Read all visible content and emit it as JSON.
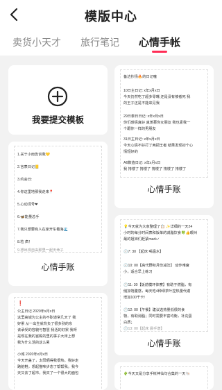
{
  "header": {
    "title": "模版中心"
  },
  "tabs": [
    {
      "label": "卖货小天才"
    },
    {
      "label": "旅行笔记"
    },
    {
      "label": "心情手帐"
    }
  ],
  "submit": {
    "label": "我要提交模板"
  },
  "templates": [
    {
      "title": "心情手账",
      "lines": [
        "备达抄扬🔥的日记噻",
        "10日主日记: x年x月x日",
        "今天仍然吃了超多零嘴 还是没有被者死 我",
        "的王子还是不能来见我",
        "29日泰日日记: x年x月x日",
        "你们感情真好 真羡慕你女朋友 我也素我一",
        "个跟你一样的男朋友",
        "31日主日记: x年x月x日",
        "今天心情不好打了两把王者 结果发现初个心",
        "情短好的",
        "A6数值日记: x年x月x日",
        "我 挎楼了 挎楼了 挎楼了 挎楼了 挎楼了",
        "挎楼了 挎楼了 挎楼了 挎楼了 挎楼了",
        "挎楼了 挎楼了 挎楼了"
      ]
    },
    {
      "title": "心情手账",
      "lines": [
        "1.关于小雨告诉我💛",
        "2.言表日记📒",
        "3.约会日:",
        "4.你这里地那我走来📍",
        "5.心动词号❤",
        "6.🦋能量总手",
        "7.我只想要有人在家开车看海🌊",
        "8.粒 疯！",
        "9.想出现自由那里一起天命子"
      ]
    },
    {
      "title": "心情手账",
      "lines": [
        "💡今天就为大家整理了📋 ✨详细的一天24",
        "小时的每分时间表和饭单的减脂饮食🍀👍眼州",
        "最的姐妹们赶紧mark✓",
        "🕖7: 30 【起床 喝温水】",
        "🕘10: 00【高代野积月份减法】 动作难度",
        "小，适合早上练习",
        "🕚11: 30【饭前模环体察】有助于燃脂，有",
        "储加饱腹感，每天吃4种绿茶叶控热量代谢",
        "增加100千卡!",
        "🕛12: 00【午餐】建议选热量低很的食",
        "物，有助消脂；同时需要丰富均衡，补充蛋",
        "白质；",
        "🕐13: 00【起床 晨手谱】"
      ]
    },
    {
      "title": "",
      "lines": [
        "❗",
        "公主日记 2020年x月x日",
        "这里高城为公主的不职道常几天了 我",
        "好累 从一出生就背负了很多别的东",
        "该承受的容貌与智慧 我活的好累 我呀",
        "是现在我的宫殿的里的事子大床上想",
        "我为什么活的这么累",
        "小城 2020年x月x日",
        "今天开盖了，太阳晒得我很热。我好走",
        "路脏鞋，想起猫咪步态了帮帮我。我今",
        "天又去了超市，我买了一个很大的面包"
      ]
    },
    {
      "title": "",
      "lines": [
        "🌵今天又是分享手帐神仙句合集的一天🐚"
      ]
    }
  ]
}
